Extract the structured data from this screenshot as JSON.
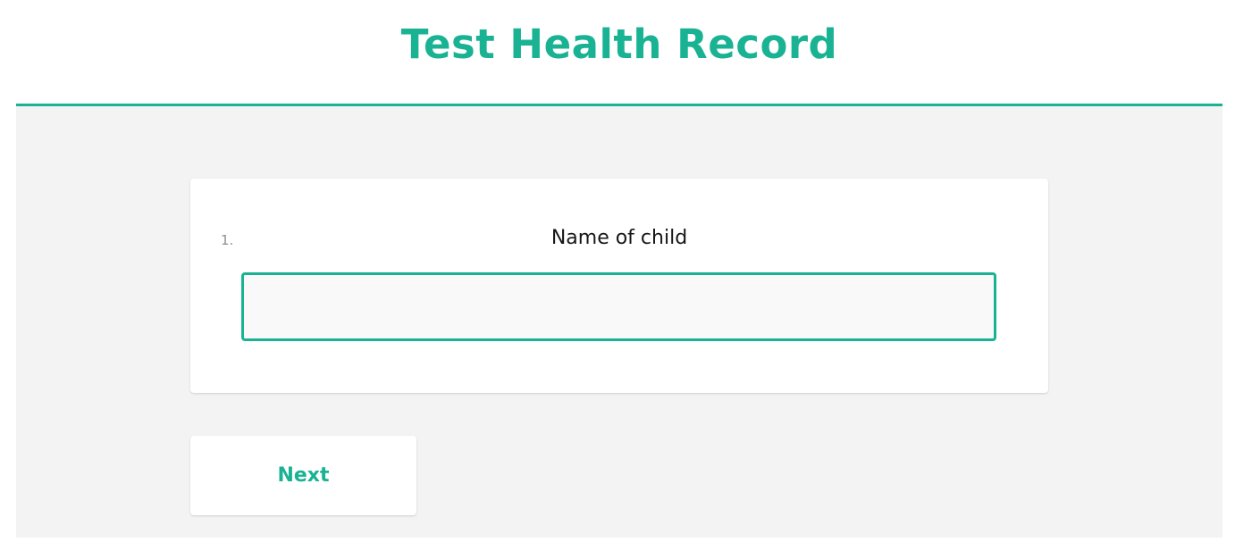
{
  "survey": {
    "title": "Test Health Record"
  },
  "question": {
    "number": "1.",
    "title": "Name of child",
    "input_value": "",
    "input_placeholder": ""
  },
  "navigation": {
    "next_label": "Next"
  },
  "colors": {
    "accent": "#19b394",
    "page_background": "#f3f3f3",
    "card_background": "#ffffff",
    "input_background": "#f9f9f9"
  }
}
